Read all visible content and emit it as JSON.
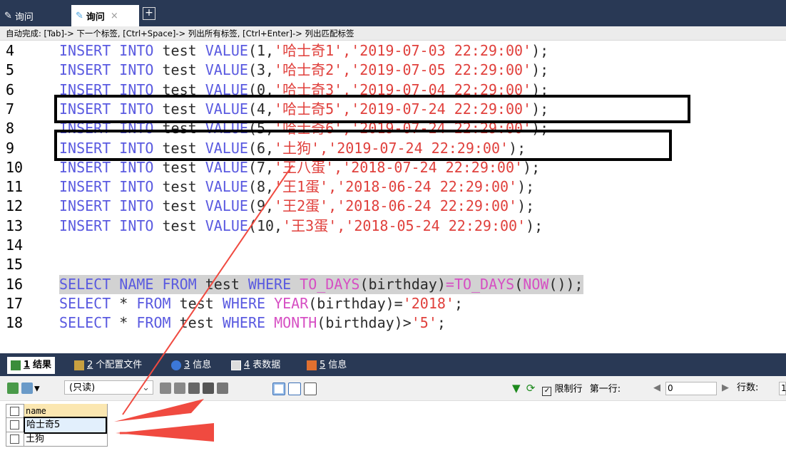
{
  "tabs": [
    {
      "label": "询问",
      "active": false
    },
    {
      "label": "询问",
      "active": true,
      "close": "×"
    }
  ],
  "add_tab": "+",
  "autocomplete_hint": "自动完成: [Tab]-> 下一个标签, [Ctrl+Space]-> 列出所有标签, [Ctrl+Enter]-> 列出匹配标签",
  "editor_lines": [
    {
      "n": "4",
      "parts": [
        [
          "kw",
          "INSERT INTO "
        ],
        [
          "tx",
          "test "
        ],
        [
          "kw",
          "VALUE"
        ],
        [
          "tx",
          "(1,"
        ],
        [
          "str",
          "'哈士奇1','2019-07-03 22:29:00'"
        ],
        [
          "tx",
          ");"
        ]
      ]
    },
    {
      "n": "5",
      "parts": [
        [
          "kw",
          "INSERT INTO "
        ],
        [
          "tx",
          "test "
        ],
        [
          "kw",
          "VALUE"
        ],
        [
          "tx",
          "(3,"
        ],
        [
          "str",
          "'哈士奇2','2019-07-05 22:29:00'"
        ],
        [
          "tx",
          ");"
        ]
      ]
    },
    {
      "n": "6",
      "parts": [
        [
          "kw",
          "INSERT INTO "
        ],
        [
          "tx",
          "test "
        ],
        [
          "kw",
          "VALUE"
        ],
        [
          "tx",
          "(0,"
        ],
        [
          "str",
          "'哈士奇3','2019-07-04 22:29:00'"
        ],
        [
          "tx",
          ");"
        ]
      ]
    },
    {
      "n": "7",
      "parts": [
        [
          "kw",
          "INSERT INTO "
        ],
        [
          "tx",
          "test "
        ],
        [
          "kw",
          "VALUE"
        ],
        [
          "tx",
          "(4,"
        ],
        [
          "str",
          "'哈士奇5','2019-07-24 22:29:00'"
        ],
        [
          "tx",
          ");"
        ]
      ]
    },
    {
      "n": "8",
      "parts": [
        [
          "kw",
          "INSERT INTO "
        ],
        [
          "tx",
          "test "
        ],
        [
          "kw",
          "VALUE"
        ],
        [
          "tx",
          "(5,"
        ],
        [
          "str",
          "'哈士奇6','2019-07-24 22:29:00'"
        ],
        [
          "tx",
          ");"
        ]
      ]
    },
    {
      "n": "9",
      "parts": [
        [
          "kw",
          "INSERT INTO "
        ],
        [
          "tx",
          "test "
        ],
        [
          "kw",
          "VALUE"
        ],
        [
          "tx",
          "(6,"
        ],
        [
          "str",
          "'土狗','2019-07-24 22:29:00'"
        ],
        [
          "tx",
          ");"
        ]
      ]
    },
    {
      "n": "10",
      "parts": [
        [
          "kw",
          "INSERT INTO "
        ],
        [
          "tx",
          "test "
        ],
        [
          "kw",
          "VALUE"
        ],
        [
          "tx",
          "(7,"
        ],
        [
          "str",
          "'王八蛋','2018-07-24 22:29:00'"
        ],
        [
          "tx",
          ");"
        ]
      ]
    },
    {
      "n": "11",
      "parts": [
        [
          "kw",
          "INSERT INTO "
        ],
        [
          "tx",
          "test "
        ],
        [
          "kw",
          "VALUE"
        ],
        [
          "tx",
          "(8,"
        ],
        [
          "str",
          "'王1蛋','2018-06-24 22:29:00'"
        ],
        [
          "tx",
          ");"
        ]
      ]
    },
    {
      "n": "12",
      "parts": [
        [
          "kw",
          "INSERT INTO "
        ],
        [
          "tx",
          "test "
        ],
        [
          "kw",
          "VALUE"
        ],
        [
          "tx",
          "(9,"
        ],
        [
          "str",
          "'王2蛋','2018-06-24 22:29:00'"
        ],
        [
          "tx",
          ");"
        ]
      ]
    },
    {
      "n": "13",
      "parts": [
        [
          "kw",
          "INSERT INTO "
        ],
        [
          "tx",
          "test "
        ],
        [
          "kw",
          "VALUE"
        ],
        [
          "tx",
          "(10,"
        ],
        [
          "str",
          "'王3蛋','2018-05-24 22:29:00'"
        ],
        [
          "tx",
          ");"
        ]
      ]
    },
    {
      "n": "14",
      "parts": []
    },
    {
      "n": "15",
      "parts": []
    },
    {
      "n": "16",
      "highlight": true,
      "parts": [
        [
          "kw",
          "SELECT NAME FROM "
        ],
        [
          "tx",
          "test "
        ],
        [
          "kw",
          "WHERE "
        ],
        [
          "fn",
          "TO_DAYS"
        ],
        [
          "tx",
          "(birthday)"
        ],
        [
          "fn",
          "="
        ],
        [
          "fn",
          "TO_DAYS"
        ],
        [
          "tx",
          "("
        ],
        [
          "fn",
          "NOW"
        ],
        [
          "tx",
          "());"
        ]
      ]
    },
    {
      "n": "17",
      "parts": [
        [
          "kw",
          "SELECT "
        ],
        [
          "tx",
          "* "
        ],
        [
          "kw",
          "FROM "
        ],
        [
          "tx",
          "test "
        ],
        [
          "kw",
          "WHERE "
        ],
        [
          "fn",
          "YEAR"
        ],
        [
          "tx",
          "(birthday)="
        ],
        [
          "str",
          "'2018'"
        ],
        [
          "tx",
          ";"
        ]
      ]
    },
    {
      "n": "18",
      "parts": [
        [
          "kw",
          "SELECT "
        ],
        [
          "tx",
          "* "
        ],
        [
          "kw",
          "FROM "
        ],
        [
          "tx",
          "test "
        ],
        [
          "kw",
          "WHERE "
        ],
        [
          "fn",
          "MONTH"
        ],
        [
          "tx",
          "(birthday)>"
        ],
        [
          "str",
          "'5'"
        ],
        [
          "tx",
          ";"
        ]
      ]
    }
  ],
  "result_tabs": [
    {
      "num": "1",
      "label": "结果",
      "active": true
    },
    {
      "num": "2",
      "label": "个配置文件",
      "active": false
    },
    {
      "num": "3",
      "label": "信息",
      "active": false
    },
    {
      "num": "4",
      "label": "表数据",
      "active": false
    },
    {
      "num": "5",
      "label": "信息",
      "active": false
    }
  ],
  "toolbar": {
    "mode": "(只读)",
    "limit_rows": "限制行",
    "first_row_label": "第一行:",
    "first_row_value": "0",
    "row_count_label": "行数:",
    "row_count_value": "1"
  },
  "result_grid": {
    "header": "name",
    "rows": [
      "哈士奇5",
      "土狗"
    ]
  },
  "colors": {
    "keyword": "#5a5ae0",
    "string": "#e0403c",
    "function": "#d64fc3",
    "tabbar": "#293955",
    "arrow": "#f04a40"
  }
}
